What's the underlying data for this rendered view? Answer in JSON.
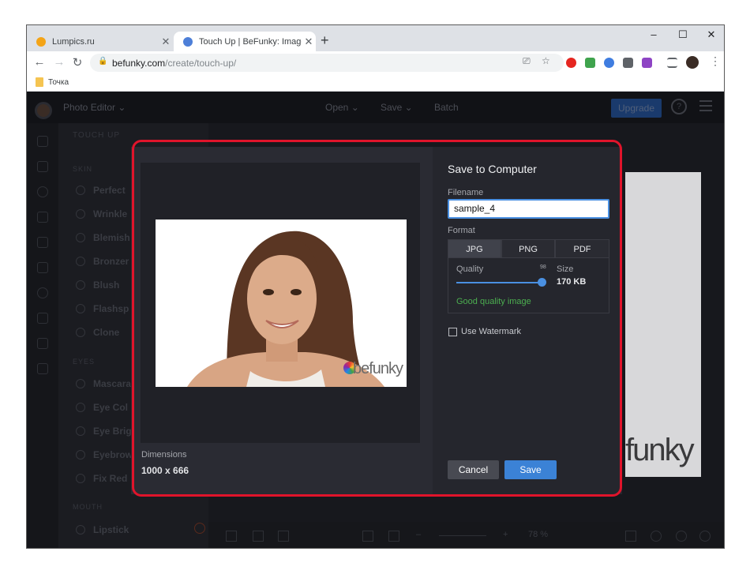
{
  "browser": {
    "tabs": [
      {
        "title": "Lumpics.ru",
        "close": "✕",
        "favicon_color": "#f4a417"
      },
      {
        "title": "Touch Up | BeFunky: Image Retou",
        "close": "✕",
        "favicon_color": "#4d7fd8"
      }
    ],
    "new_tab": "+",
    "window_controls": {
      "minimize": "–",
      "maximize": "☐",
      "close": "✕"
    },
    "nav": {
      "back": "←",
      "forward": "→",
      "reload": "↻"
    },
    "address": {
      "domain": "befunky.com",
      "path": "/create/touch-up/",
      "lock": "🔒"
    },
    "omnibox_icons": {
      "cast": "⎚",
      "star": "☆"
    },
    "extensions": [
      {
        "name": "opera-icon",
        "color": "#e52620"
      },
      {
        "name": "check-icon",
        "color": "#3fa34d"
      },
      {
        "name": "globe-icon",
        "color": "#3f7de0"
      },
      {
        "name": "puzzle-icon",
        "color": "#5f6368"
      },
      {
        "name": "ext-purple-icon",
        "color": "#8e44c4"
      }
    ],
    "menu_glyph": "⋮",
    "bookmarks": [
      {
        "label": "Точка"
      }
    ]
  },
  "app": {
    "topbar": {
      "photo_editor": "Photo Editor ⌄",
      "open": "Open ⌄",
      "save": "Save ⌄",
      "batch": "Batch",
      "upgrade": "Upgrade",
      "help": "?"
    },
    "panel": {
      "title": "TOUCH UP",
      "sections": [
        {
          "label": "SKIN",
          "items": [
            "Perfect",
            "Wrinkle",
            "Blemish",
            "Bronzer",
            "Blush",
            "Flashsp",
            "Clone"
          ]
        },
        {
          "label": "EYES",
          "items": [
            "Mascara",
            "Eye Col",
            "Eye Brig",
            "Eyebrow",
            "Fix Red"
          ]
        },
        {
          "label": "MOUTH",
          "items": [
            "Lipstick"
          ]
        }
      ]
    },
    "bottombar": {
      "minus": "–",
      "plus": "+",
      "zoom": "78 %"
    },
    "canvas_watermark": "funky"
  },
  "dialog": {
    "dimensions_label": "Dimensions",
    "dimensions_value": "1000 x 666",
    "preview_watermark": "befunky",
    "title": "Save to Computer",
    "filename_label": "Filename",
    "filename_value": "sample_4",
    "format_label": "Format",
    "formats": [
      "JPG",
      "PNG",
      "PDF"
    ],
    "selected_format": "JPG",
    "quality_label": "Quality",
    "quality_value": "98",
    "quality_fraction": 0.98,
    "size_label": "Size",
    "size_value": "170 KB",
    "quality_note": "Good quality image",
    "watermark_label": "Use Watermark",
    "watermark_checked": false,
    "cancel_label": "Cancel",
    "save_label": "Save",
    "highlight_color": "#e0142b",
    "accent_color": "#3b82d6"
  }
}
